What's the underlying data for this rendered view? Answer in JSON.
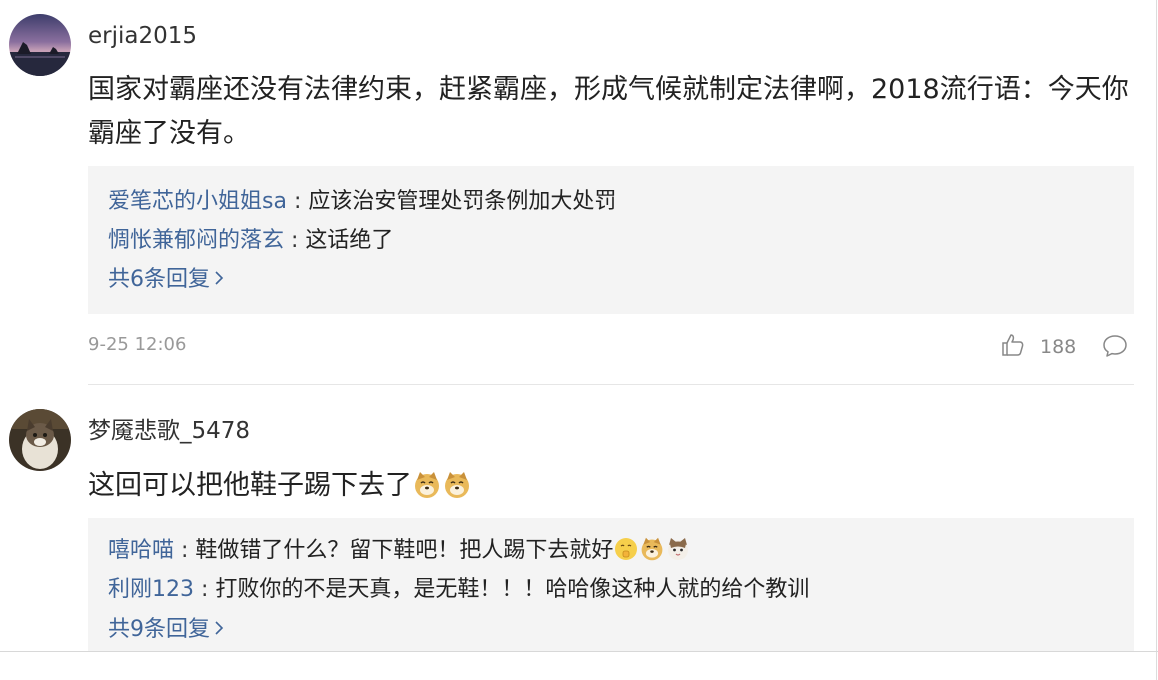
{
  "comments": [
    {
      "username": "erjia2015",
      "content": "国家对霸座还没有法律约束，赶紧霸座，形成气候就制定法律啊，2018流行语：今天你霸座了没有。",
      "replies": [
        {
          "name": "爱笔芯的小姐姐sa",
          "sep": " : ",
          "text": "应该治安管理处罚条例加大处罚"
        },
        {
          "name": "惆怅兼郁闷的落玄",
          "sep": " : ",
          "text": "这话绝了"
        }
      ],
      "more_label": "共6条回复",
      "time": "9-25 12:06",
      "likes": "188"
    },
    {
      "username": "梦魇悲歌_5478",
      "content": "这回可以把他鞋子踢下去了",
      "content_emojis": [
        "doge-emoji",
        "doge-emoji"
      ],
      "replies": [
        {
          "name": "嘻哈喵",
          "sep": " : ",
          "text": "鞋做错了什么？留下鞋吧！把人踢下去就好",
          "emojis": [
            "shush-emoji",
            "doge-emoji",
            "cat-emoji"
          ]
        },
        {
          "name": "利刚123",
          "sep": " : ",
          "text": "打败你的不是天真，是无鞋！！！哈哈像这种人就的给个教训"
        }
      ],
      "more_label": "共9条回复"
    }
  ],
  "icons": {
    "like": "thumbs-up-icon",
    "reply": "speech-bubble-icon",
    "more": "chevron-right-icon"
  },
  "colors": {
    "link": "#406599",
    "reply_bg": "#f4f4f4",
    "meta": "#999999"
  }
}
